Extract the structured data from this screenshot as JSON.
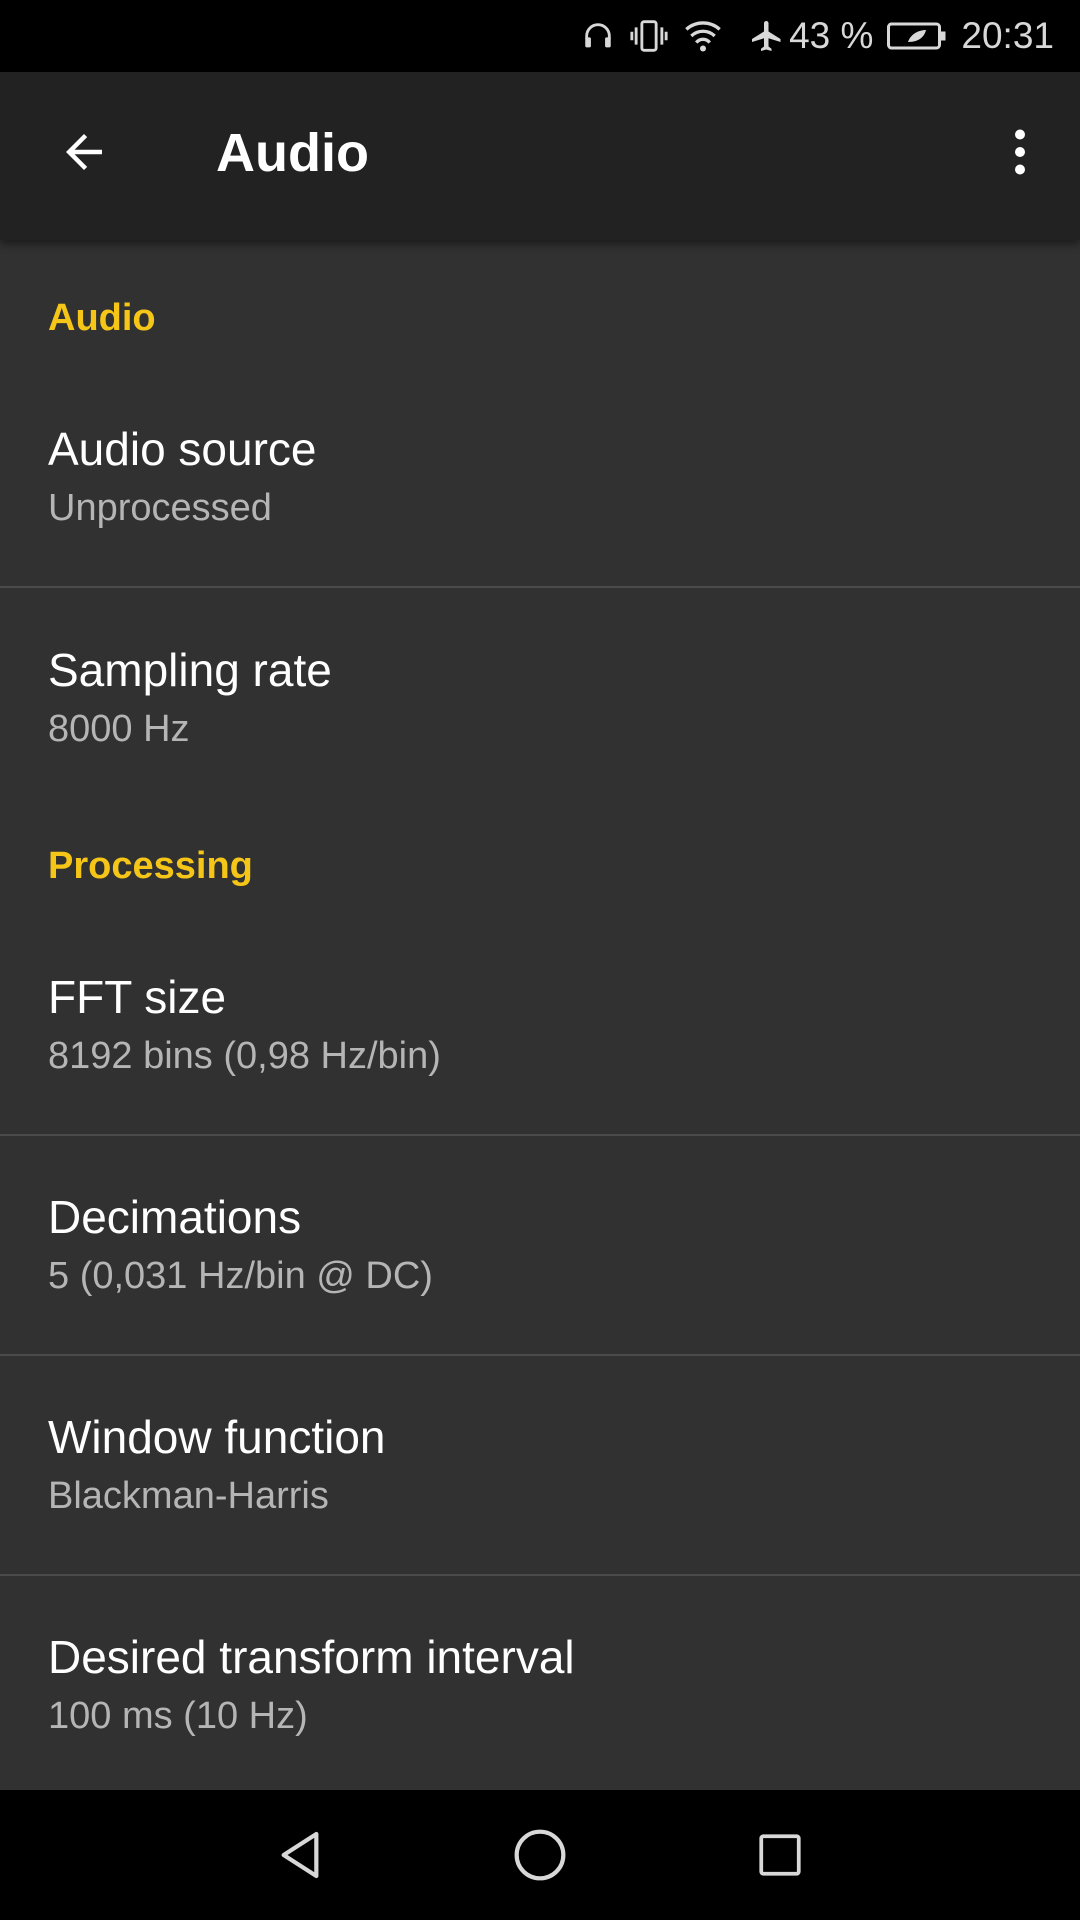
{
  "status_bar": {
    "battery_percent": "43 %",
    "time": "20:31",
    "icons": [
      "headphones-icon",
      "vibrate-icon",
      "wifi-icon",
      "airplane-icon",
      "battery-icon"
    ]
  },
  "app_bar": {
    "title": "Audio",
    "back_icon": "arrow-left-icon",
    "menu_icon": "more-vert-icon"
  },
  "sections": [
    {
      "header": "Audio",
      "items": [
        {
          "title": "Audio source",
          "summary": "Unprocessed"
        },
        {
          "title": "Sampling rate",
          "summary": "8000 Hz"
        }
      ]
    },
    {
      "header": "Processing",
      "items": [
        {
          "title": "FFT size",
          "summary": "8192 bins (0,98 Hz/bin)"
        },
        {
          "title": "Decimations",
          "summary": "5 (0,031 Hz/bin @ DC)"
        },
        {
          "title": "Window function",
          "summary": "Blackman-Harris"
        },
        {
          "title": "Desired transform interval",
          "summary": "100 ms (10 Hz)"
        }
      ]
    }
  ],
  "colors": {
    "accent": "#f5c518",
    "background": "#313131",
    "app_bar": "#222222"
  },
  "nav_bar": {
    "icons": [
      "back-triangle-icon",
      "home-circle-icon",
      "recents-square-icon"
    ]
  }
}
